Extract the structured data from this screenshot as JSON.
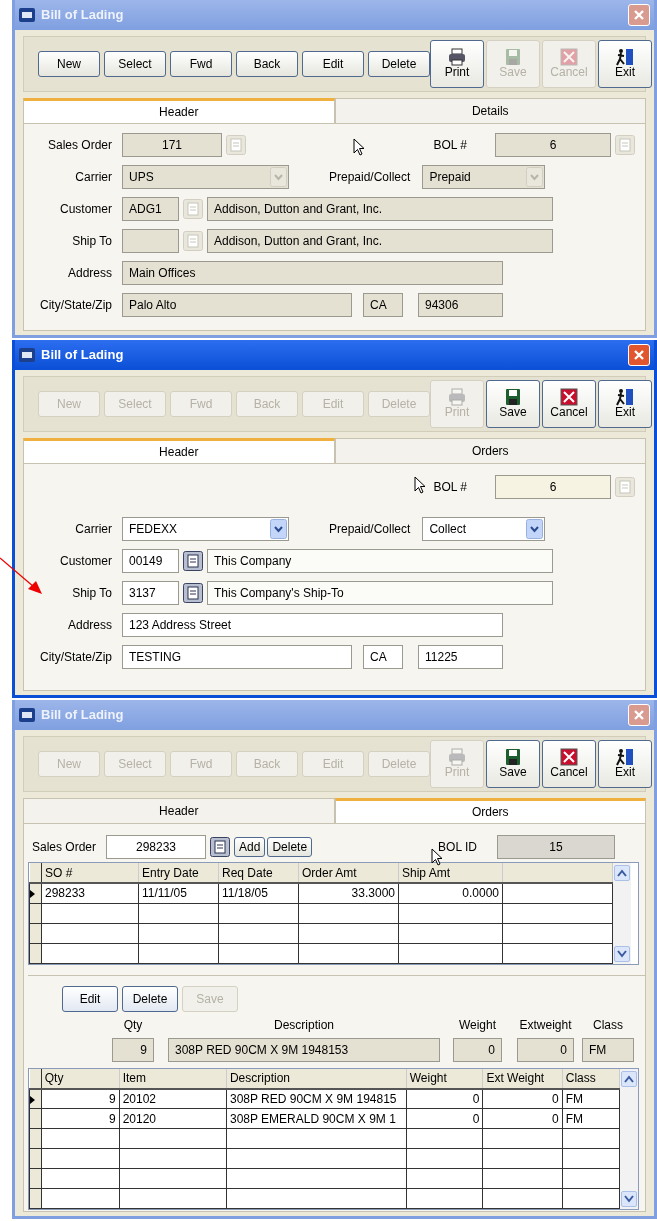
{
  "windows": [
    {
      "title": "Bill of Lading",
      "active": false,
      "kind": "header",
      "toolbar": [
        {
          "label": "New",
          "disabled": false
        },
        {
          "label": "Select",
          "disabled": false
        },
        {
          "label": "Fwd",
          "disabled": false
        },
        {
          "label": "Back",
          "disabled": false
        },
        {
          "label": "Edit",
          "disabled": false
        },
        {
          "label": "Delete",
          "disabled": false
        }
      ],
      "actions": [
        {
          "label": "Print",
          "kind": "print",
          "disabled": false
        },
        {
          "label": "Save",
          "kind": "save",
          "disabled": true
        },
        {
          "label": "Cancel",
          "kind": "cancel",
          "disabled": true
        },
        {
          "label": "Exit",
          "kind": "exit",
          "disabled": false
        }
      ],
      "tabs": [
        {
          "label": "Header",
          "selected": true
        },
        {
          "label": "Details",
          "selected": false
        }
      ],
      "form": {
        "editable": false,
        "sales_order_label": "Sales Order",
        "sales_order": "171",
        "bol_label": "BOL #",
        "bol": "6",
        "carrier_label": "Carrier",
        "carrier": "UPS",
        "prepaid_label": "Prepaid/Collect",
        "prepaid": "Prepaid",
        "customer_label": "Customer",
        "customer_code": "ADG1",
        "customer_name": "Addison, Dutton and Grant, Inc.",
        "ship_to_label": "Ship To",
        "ship_to_name": "Addison, Dutton and Grant, Inc.",
        "address_label": "Address",
        "address": "Main Offices",
        "city_label": "City/State/Zip",
        "city": "Palo Alto",
        "state": "CA",
        "zip": "94306"
      }
    },
    {
      "title": "Bill of Lading",
      "active": true,
      "kind": "header",
      "toolbar": [
        {
          "label": "New",
          "disabled": true
        },
        {
          "label": "Select",
          "disabled": true
        },
        {
          "label": "Fwd",
          "disabled": true
        },
        {
          "label": "Back",
          "disabled": true
        },
        {
          "label": "Edit",
          "disabled": true
        },
        {
          "label": "Delete",
          "disabled": true
        }
      ],
      "actions": [
        {
          "label": "Print",
          "kind": "print",
          "disabled": true
        },
        {
          "label": "Save",
          "kind": "save",
          "disabled": false
        },
        {
          "label": "Cancel",
          "kind": "cancel",
          "disabled": false
        },
        {
          "label": "Exit",
          "kind": "exit",
          "disabled": false
        }
      ],
      "tabs": [
        {
          "label": "Header",
          "selected": true
        },
        {
          "label": "Orders",
          "selected": false
        }
      ],
      "form": {
        "editable": true,
        "bol_label": "BOL #",
        "bol": "6",
        "carrier_label": "Carrier",
        "carrier": "FEDEXX",
        "prepaid_label": "Prepaid/Collect",
        "prepaid": "Collect",
        "customer_label": "Customer",
        "customer_code": "00149",
        "customer_name": "This Company",
        "ship_to_label": "Ship To",
        "ship_to_code": "3137",
        "ship_to_name": "This Company's Ship-To",
        "address_label": "Address",
        "address": "123 Address Street",
        "city_label": "City/State/Zip",
        "city": "TESTING",
        "state": "CA",
        "zip": "11225"
      }
    },
    {
      "title": "Bill of Lading",
      "active": false,
      "kind": "orders",
      "toolbar": [
        {
          "label": "New",
          "disabled": true
        },
        {
          "label": "Select",
          "disabled": true
        },
        {
          "label": "Fwd",
          "disabled": true
        },
        {
          "label": "Back",
          "disabled": true
        },
        {
          "label": "Edit",
          "disabled": true
        },
        {
          "label": "Delete",
          "disabled": true
        }
      ],
      "actions": [
        {
          "label": "Print",
          "kind": "print",
          "disabled": true
        },
        {
          "label": "Save",
          "kind": "save",
          "disabled": false
        },
        {
          "label": "Cancel",
          "kind": "cancel",
          "disabled": false
        },
        {
          "label": "Exit",
          "kind": "exit",
          "disabled": false
        }
      ],
      "tabs": [
        {
          "label": "Header",
          "selected": false
        },
        {
          "label": "Orders",
          "selected": true
        }
      ],
      "orders": {
        "sales_order_label": "Sales Order",
        "sales_order": "298233",
        "add": "Add",
        "delete": "Delete",
        "bol_id_label": "BOL ID",
        "bol_id": "15",
        "columns": [
          {
            "label": "SO #",
            "numeric": false
          },
          {
            "label": "Entry Date",
            "numeric": false
          },
          {
            "label": "Req Date",
            "numeric": false
          },
          {
            "label": "Order Amt",
            "numeric": true
          },
          {
            "label": "Ship Amt",
            "numeric": true
          }
        ],
        "rows": [
          {
            "current": true,
            "cells": [
              "298233",
              "11/11/05",
              "11/18/05",
              "33.3000",
              "0.0000"
            ]
          }
        ]
      },
      "line": {
        "buttons": [
          {
            "label": "Edit",
            "disabled": false
          },
          {
            "label": "Delete",
            "disabled": false
          },
          {
            "label": "Save",
            "disabled": true
          }
        ],
        "fields": [
          {
            "label": "Qty",
            "value": "9",
            "numeric": true
          },
          {
            "label": "Description",
            "value": "308P RED 90CM X 9M  1948153",
            "numeric": false
          },
          {
            "label": "Weight",
            "value": "0",
            "numeric": true
          },
          {
            "label": "Extweight",
            "value": "0",
            "numeric": true
          },
          {
            "label": "Class",
            "value": "FM",
            "numeric": false
          }
        ],
        "columns": [
          {
            "label": "Qty",
            "numeric": true
          },
          {
            "label": "Item",
            "numeric": false
          },
          {
            "label": "Description",
            "numeric": false
          },
          {
            "label": "Weight",
            "numeric": true
          },
          {
            "label": "Ext Weight",
            "numeric": true
          },
          {
            "label": "Class",
            "numeric": false
          }
        ],
        "rows": [
          {
            "current": true,
            "cells": [
              "9",
              "20102",
              "308P RED 90CM X 9M  194815",
              "0",
              "0",
              "FM"
            ]
          },
          {
            "current": false,
            "cells": [
              "9",
              "20120",
              "308P EMERALD 90CM X 9M  1",
              "0",
              "0",
              "FM"
            ]
          }
        ]
      }
    }
  ]
}
